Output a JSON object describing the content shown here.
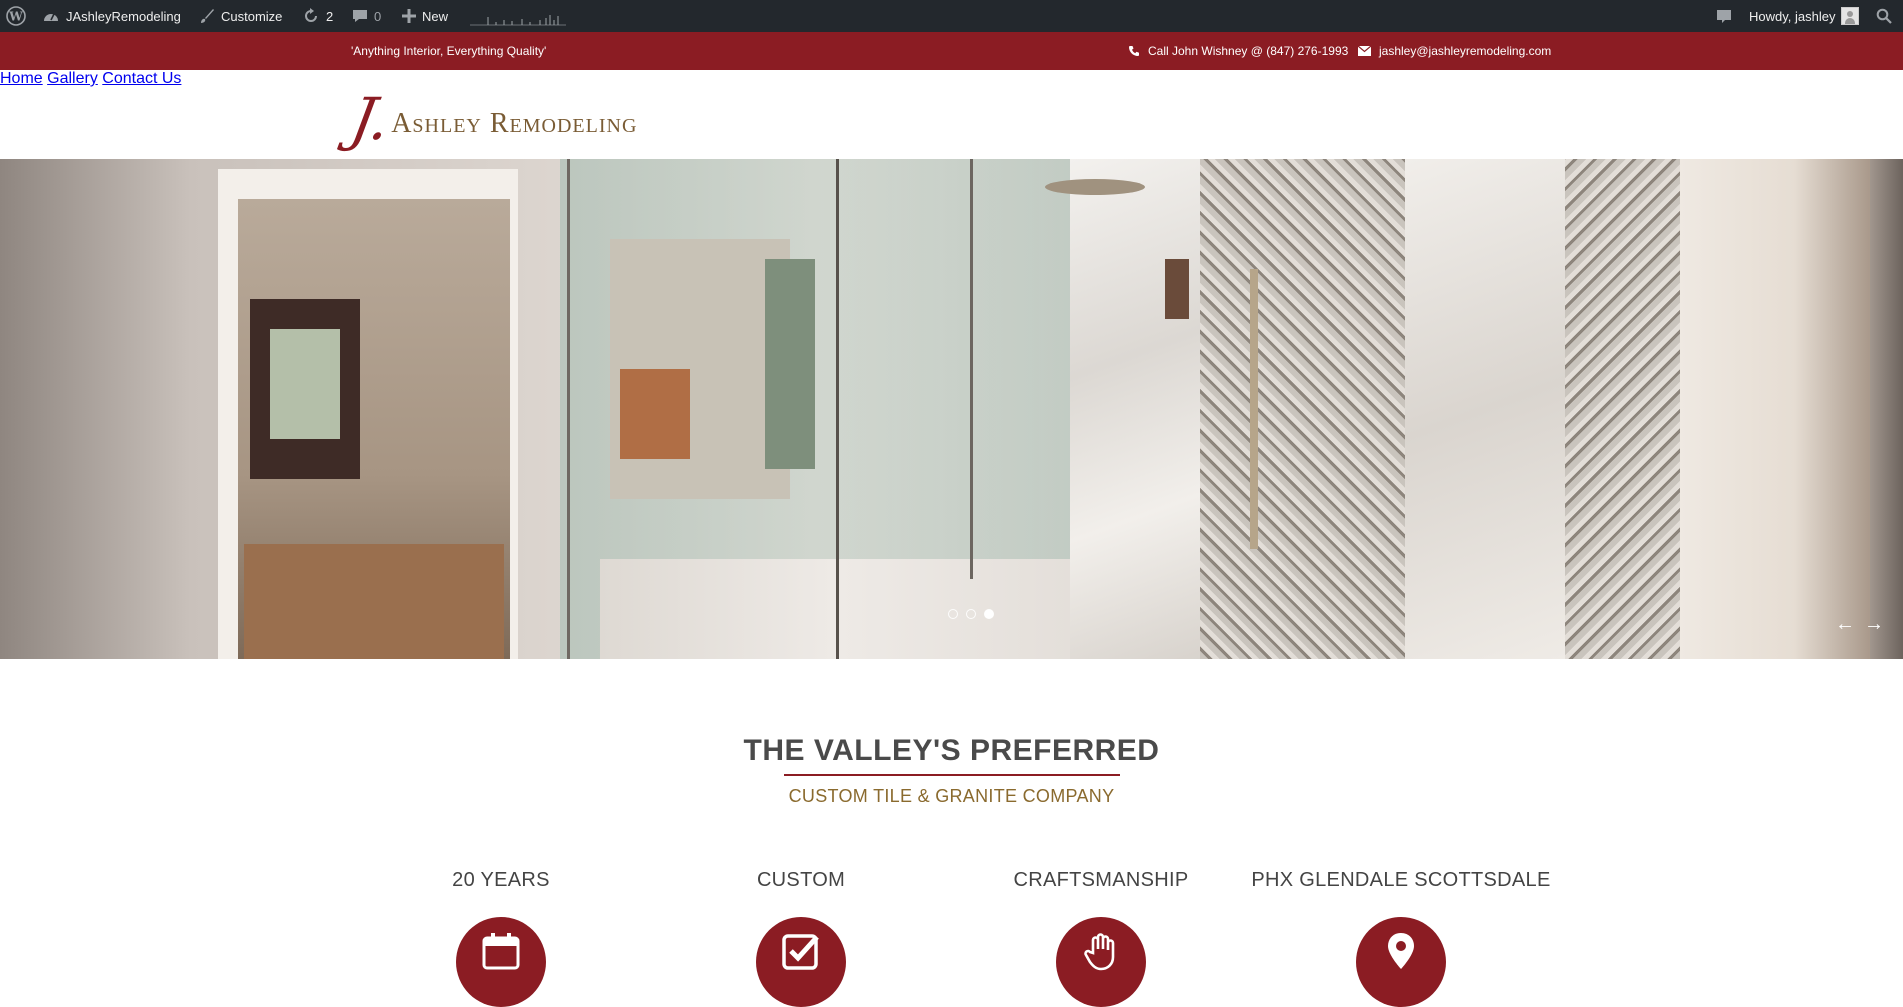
{
  "adminbar": {
    "site_name": "JAshleyRemodeling",
    "customize_label": "Customize",
    "updates_count": "2",
    "comments_count": "0",
    "new_label": "New",
    "howdy_label": "Howdy, jashley"
  },
  "topbar": {
    "tagline": "'Anything Interior, Everything Quality'",
    "phone": "Call John Wishney @ (847) 276-1993",
    "email": "jashley@jashleyremodeling.com"
  },
  "logo": {
    "initial": "J.",
    "name": "Ashley Remodeling"
  },
  "nav": {
    "items": [
      "Home",
      "Gallery",
      "Contact Us"
    ]
  },
  "slider": {
    "dots": 3,
    "active_dot": 3,
    "prev_symbol": "←",
    "next_symbol": "→"
  },
  "intro": {
    "title": "THE VALLEY'S PREFERRED",
    "subtitle": "CUSTOM TILE & GRANITE COMPANY"
  },
  "features": [
    {
      "title": "20 YEARS",
      "icon": "calendar-icon"
    },
    {
      "title": "CUSTOM",
      "icon": "check-square-icon"
    },
    {
      "title": "CRAFTSMANSHIP",
      "icon": "hand-icon"
    },
    {
      "title": "PHX GLENDALE SCOTTSDALE",
      "icon": "map-marker-icon"
    }
  ],
  "colors": {
    "brand_red": "#8b1c23",
    "brand_gold": "#8a6a2e",
    "adminbar_bg": "#23282d"
  }
}
